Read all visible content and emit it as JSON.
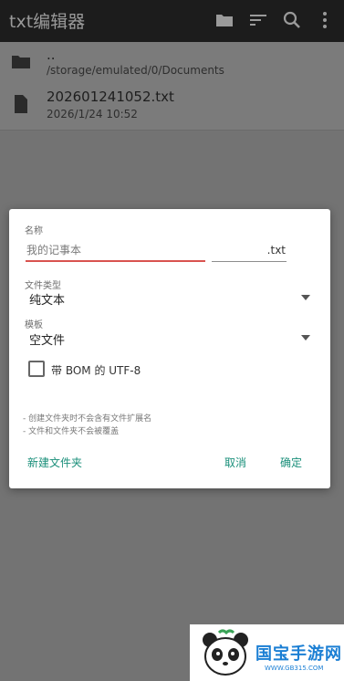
{
  "app_title": "txt编辑器",
  "toolbar_icons": [
    "folder-icon",
    "sort-icon",
    "search-icon",
    "more-vert-icon"
  ],
  "file_list": [
    {
      "name": "..",
      "detail": "/storage/emulated/0/Documents",
      "icon": "folder-icon"
    },
    {
      "name": "202601241052.txt",
      "detail": "2026/1/24 10:52",
      "icon": "file-icon"
    }
  ],
  "dialog": {
    "name_label": "名称",
    "name_placeholder": "我的记事本",
    "extension": ".txt",
    "file_type_label": "文件类型",
    "file_type_value": "纯文本",
    "template_label": "模板",
    "template_value": "空文件",
    "bom_checkbox_label": "带 BOM 的 UTF-8",
    "bom_checked": false,
    "notes": [
      "- 创建文件夹时不会含有文件扩展名",
      "- 文件和文件夹不会被覆盖"
    ],
    "new_folder_button": "新建文件夹",
    "cancel_button": "取消",
    "ok_button": "确定"
  },
  "watermark": {
    "title": "国宝手游网",
    "url": "WWW.GB315.COM"
  },
  "colors": {
    "accent": "#1a8f7a",
    "input_underline": "#d9534f",
    "watermark": "#1b7fd4"
  }
}
